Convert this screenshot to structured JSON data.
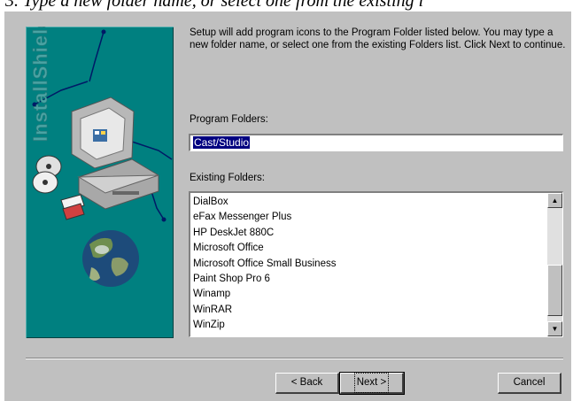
{
  "caption": "3. Type a new folder name, or select one from the existing l",
  "side_panel": {
    "brand_text": "InstallShield",
    "background": "#008080"
  },
  "description": "Setup will add program icons to the Program Folder listed below. You may type a new folder name, or select one from the existing Folders list.  Click Next to continue.",
  "program_folders": {
    "label": "Program Folders:",
    "value": "Cast/Studio"
  },
  "existing_folders": {
    "label": "Existing Folders:",
    "items": [
      "DialBox",
      "eFax Messenger Plus",
      "HP DeskJet 880C",
      "Microsoft Office",
      "Microsoft Office Small Business",
      "Paint Shop Pro 6",
      "Winamp",
      "WinRAR",
      "WinZip"
    ]
  },
  "buttons": {
    "back": "< Back",
    "next": "Next >",
    "cancel": "Cancel"
  },
  "colors": {
    "dialog": "#c0c0c0",
    "selection": "#000080"
  }
}
